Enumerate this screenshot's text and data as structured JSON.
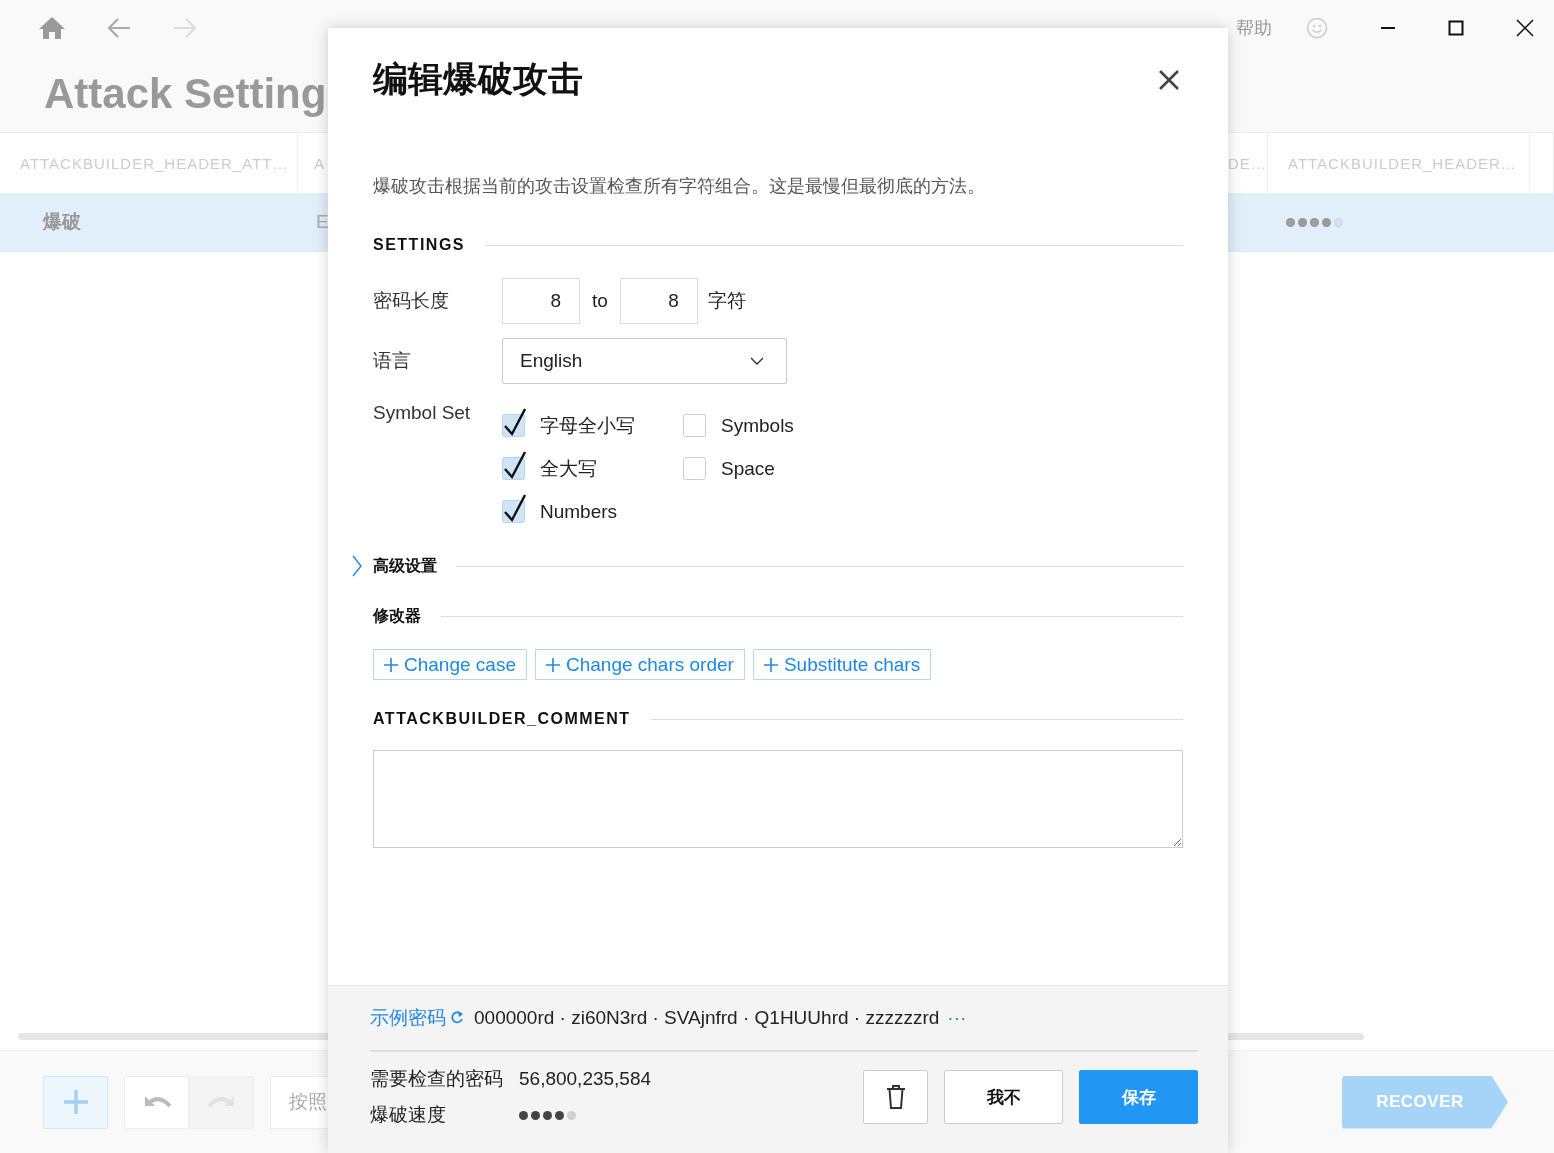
{
  "app": {
    "title": "Attack Setting",
    "menu": [
      {
        "label": "帮助"
      }
    ]
  },
  "table": {
    "columns": [
      "ATTACKBUILDER_HEADER_ATT…",
      "A",
      "DE…",
      "ATTACKBUILDER_HEADER…"
    ],
    "rows": [
      {
        "selected": true,
        "name": "爆破",
        "column_2": "E",
        "stars": 4
      }
    ]
  },
  "toolbar": {
    "redo_disabled": true,
    "sort_field": "按照",
    "recover": {
      "label": "RECOVER",
      "disabled": true
    }
  },
  "dialog": {
    "title": "编辑爆破攻击",
    "description": "爆破攻击根据当前的攻击设置检查所有字符组合。这是最慢但最彻底的方法。",
    "settings": {
      "title": "SETTINGS",
      "length_label": "密码长度",
      "min": "8",
      "to": "to",
      "max": "8",
      "unit": "字符",
      "language_label": "语言",
      "language": "English",
      "symbol_set_label": "Symbol Set",
      "symbols": [
        {
          "label": "字母全小写",
          "checked": true
        },
        {
          "label": "全大写",
          "checked": true
        },
        {
          "label": "Numbers",
          "checked": true
        },
        {
          "label": "Symbols",
          "checked": false
        },
        {
          "label": "Space",
          "checked": false
        }
      ]
    },
    "advanced": {
      "label": "高级设置",
      "expanded": false
    },
    "modifiers": {
      "title": "修改器",
      "buttons": [
        "Change case",
        "Change chars order",
        "Substitute chars"
      ]
    },
    "comment": {
      "title": "ATTACKBUILDER_COMMENT"
    },
    "footer": {
      "examples_label": "示例密码",
      "examples": "000000rd · zi60N3rd · SVAjnfrd · Q1HUUhrd · zzzzzzrd",
      "more": "···",
      "stats": [
        {
          "kind": "text",
          "label": "需要检查的密码",
          "value": "56,800,235,584"
        },
        {
          "kind": "stars",
          "label": "爆破速度",
          "stars": 4
        }
      ],
      "buttons": [
        {
          "kind": "delete"
        },
        {
          "kind": "text",
          "label": "我不"
        },
        {
          "kind": "primary",
          "label": "保存"
        }
      ]
    }
  }
}
